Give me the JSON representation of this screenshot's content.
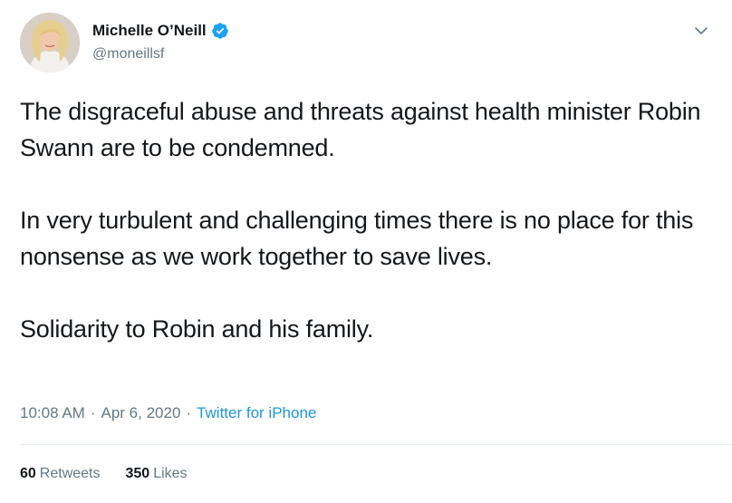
{
  "author": {
    "display_name": "Michelle O’Neill",
    "handle": "@moneillsf",
    "verified": true
  },
  "tweet": {
    "paragraphs": [
      "The disgraceful abuse and threats against health minister Robin Swann are to be condemned.",
      "In very turbulent and challenging times there is no place for this nonsense as we work together to save lives.",
      "Solidarity to Robin and his family."
    ],
    "time": "10:08 AM",
    "separator": "·",
    "date": "Apr 6, 2020",
    "source": "Twitter for iPhone"
  },
  "stats": {
    "retweets_count": "60",
    "retweets_label": "Retweets",
    "likes_count": "350",
    "likes_label": "Likes"
  },
  "icons": {
    "verified": "verified-badge-icon",
    "menu": "chevron-down-icon"
  },
  "colors": {
    "text": "#14171a",
    "secondary": "#657786",
    "link": "#1b95e0",
    "verified": "#1da1f2",
    "divider": "#e6ecf0"
  }
}
